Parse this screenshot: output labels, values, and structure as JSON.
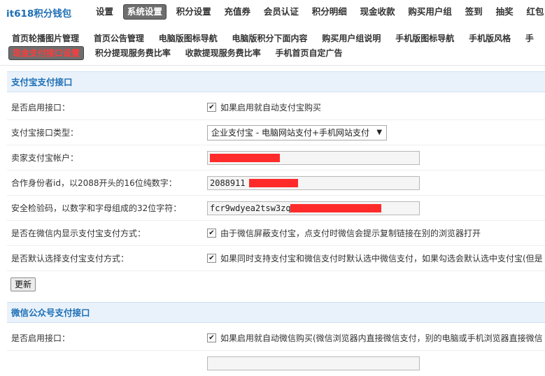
{
  "header": {
    "brand": "it618积分钱包",
    "nav": [
      "设置",
      "系统设置",
      "积分设置",
      "充值券",
      "会员认证",
      "积分明细",
      "现金收款",
      "购买用户组",
      "签到",
      "抽奖",
      "红包"
    ],
    "active_index": 1
  },
  "subnav": {
    "row1": [
      "首页轮播图片管理",
      "首页公告管理",
      "电脑版图标导航",
      "电脑版积分下面内容",
      "购买用户组说明",
      "手机版图标导航",
      "手机版风格",
      "手"
    ],
    "row2": [
      "现金支付接口设置",
      "积分提现服务费比率",
      "收款提现服务费比率",
      "手机首页自定广告"
    ],
    "active": "现金支付接口设置"
  },
  "alipay": {
    "title": "支付宝支付接口",
    "enable": {
      "label": "是否启用接口：",
      "checked": true,
      "text": "如果启用就自动支付宝购买"
    },
    "type": {
      "label": "支付宝接口类型：",
      "value": "企业支付宝 - 电脑网站支付+手机网站支付"
    },
    "account": {
      "label": "卖家支付宝帐户：",
      "value": ""
    },
    "partner": {
      "label": "合作身份者id，以2088开头的16位纯数字：",
      "value": "2088911"
    },
    "key": {
      "label": "安全检验码，以数字和字母组成的32位字符：",
      "value": "fcr9wdyea2tsw3zq"
    },
    "wechat_show": {
      "label": "是否在微信内显示支付宝支付方式：",
      "checked": true,
      "text": "由于微信屏蔽支付宝，点支付时微信会提示复制链接在别的浏览器打开"
    },
    "default_select": {
      "label": "是否默认选择支付宝支付方式：",
      "checked": true,
      "text": "如果同时支持支付宝和微信支付时默认选中微信支付，如果勾选会默认选中支付宝(但是"
    }
  },
  "submit_label": "更新",
  "wechat": {
    "title": "微信公众号支付接口",
    "enable": {
      "label": "是否启用接口：",
      "checked": true,
      "text": "如果启用就自动微信购买(微信浏览器内直接微信支付，别的电脑或手机浏览器直接微信"
    }
  },
  "colors": {
    "accent": "#1e6fb5",
    "section_bg": "#e9f2fb",
    "active_tab_bg": "#6e6e6e",
    "active_sub_text": "#ff3b3b",
    "redaction": "#ff2a2a"
  }
}
